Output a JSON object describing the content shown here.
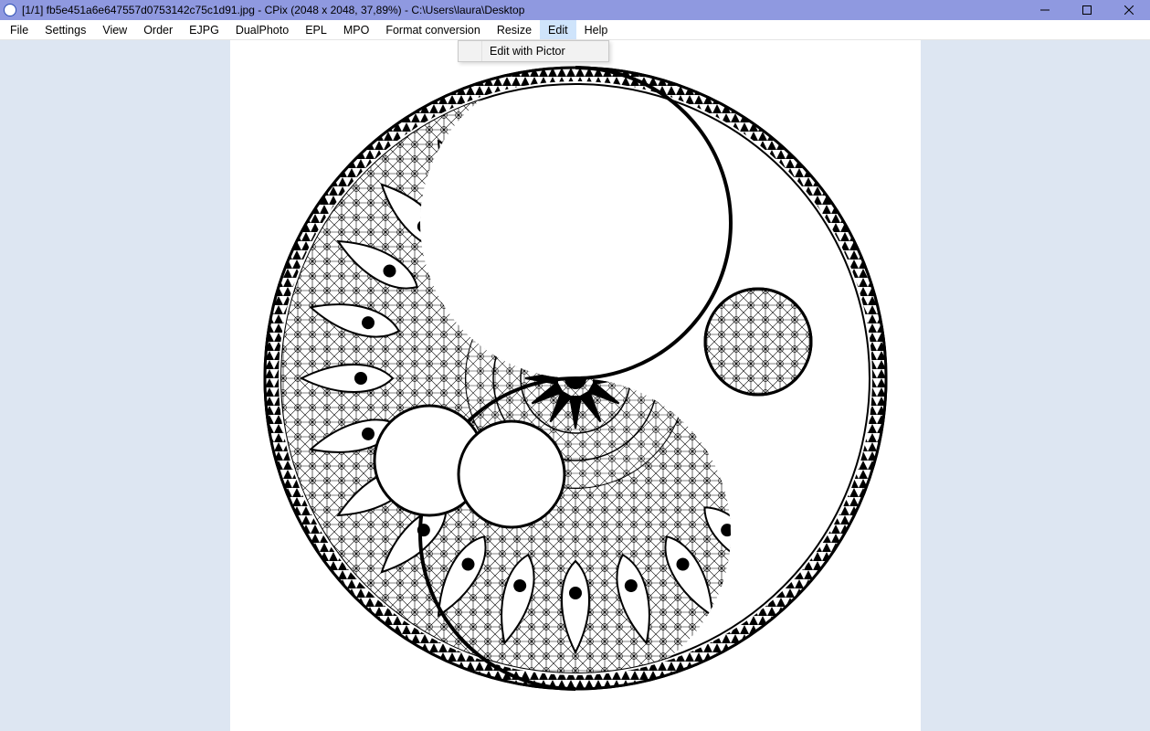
{
  "titlebar": {
    "text": "[1/1] fb5e451a6e647557d0753142c75c1d91.jpg - CPix (2048 x 2048, 37,89%) - C:\\Users\\laura\\Desktop"
  },
  "menubar": {
    "items": [
      {
        "label": "File"
      },
      {
        "label": "Settings"
      },
      {
        "label": "View"
      },
      {
        "label": "Order"
      },
      {
        "label": "EJPG"
      },
      {
        "label": "DualPhoto"
      },
      {
        "label": "EPL"
      },
      {
        "label": "MPO"
      },
      {
        "label": "Format conversion"
      },
      {
        "label": "Resize"
      },
      {
        "label": "Edit",
        "active": true
      },
      {
        "label": "Help"
      }
    ]
  },
  "dropdown": {
    "items": [
      {
        "label": "Edit with Pictor"
      }
    ]
  }
}
